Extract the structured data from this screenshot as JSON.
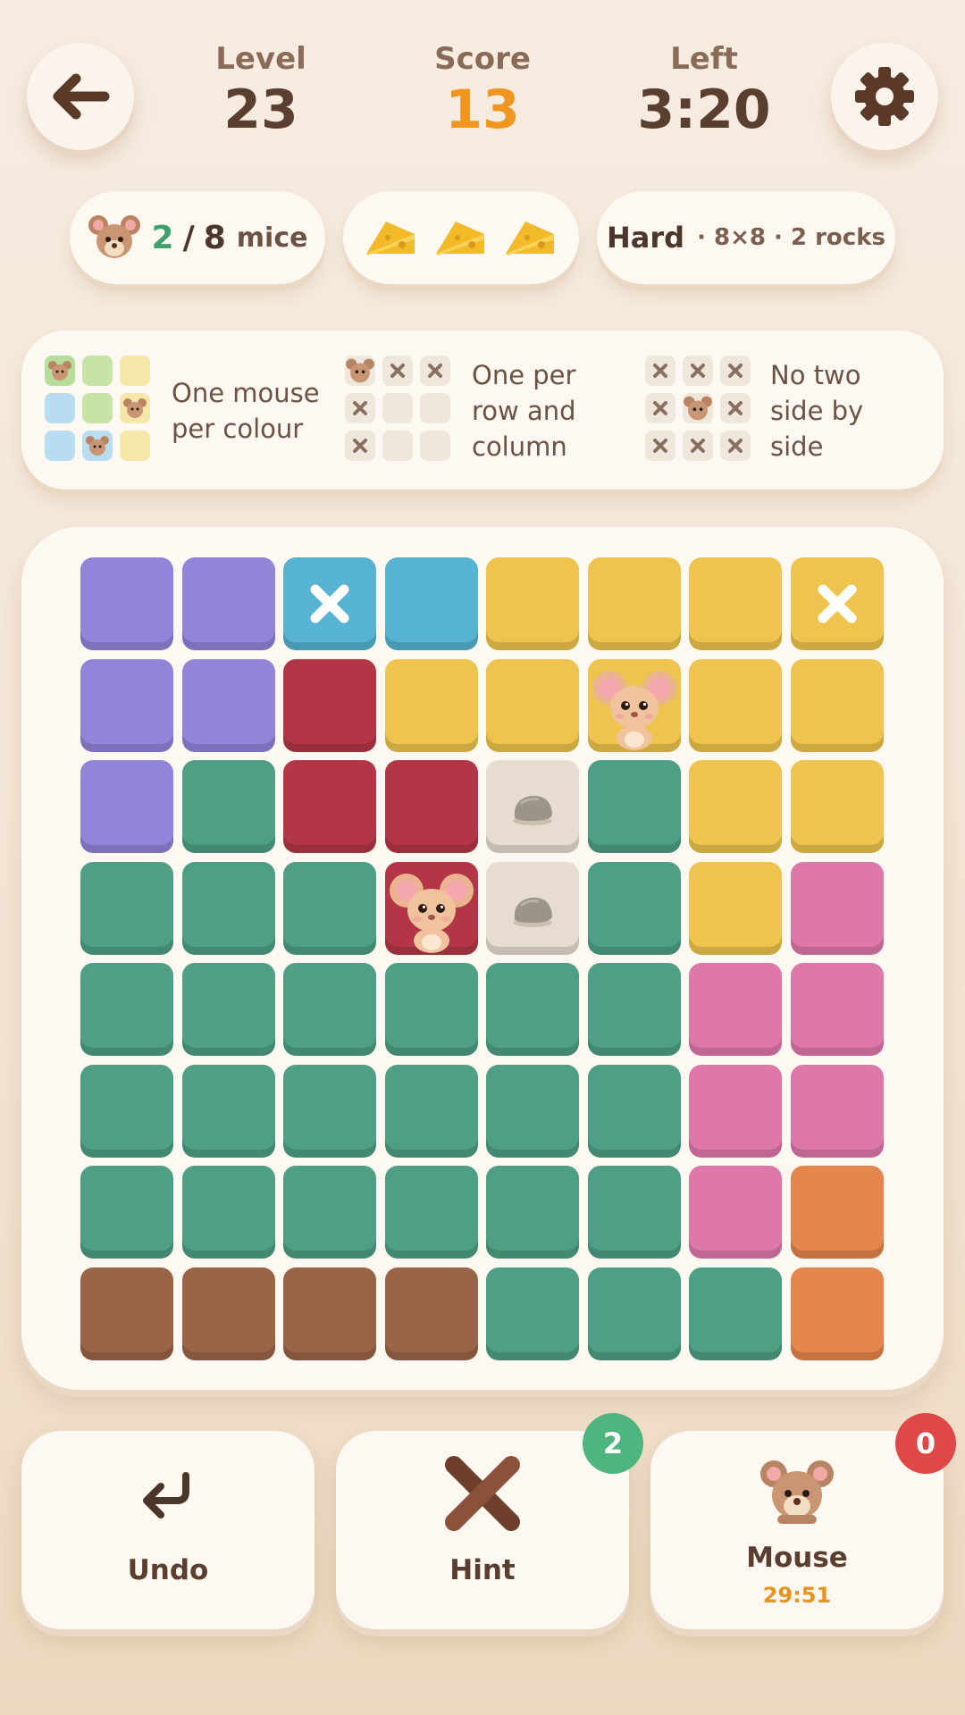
{
  "header": {
    "level_label": "Level",
    "level_value": "23",
    "score_label": "Score",
    "score_value": "13",
    "left_label": "Left",
    "left_value": "3:20"
  },
  "status": {
    "mice_found": "2",
    "mice_sep": "/",
    "mice_total": "8",
    "mice_label": "mice",
    "difficulty": "Hard",
    "board_info": "· 8×8 · 2 rocks",
    "cheese_count": 3
  },
  "rules": [
    {
      "text_line1": "One mouse",
      "text_line2": "per colour"
    },
    {
      "text_line1": "One per",
      "text_line2": "row and",
      "text_line3": "column"
    },
    {
      "text_line1": "No two",
      "text_line2": "side by",
      "text_line3": "side"
    }
  ],
  "colors": {
    "purple": "#9284d8",
    "blue": "#56b3d1",
    "yellow": "#eec44e",
    "red": "#b33647",
    "rock": "#e6dcd0",
    "green": "#4f9f86",
    "pink": "#df78aa",
    "orange": "#e6854c",
    "brown": "#9a6547"
  },
  "board": {
    "rows": [
      [
        "purple",
        "purple",
        "blue",
        "blue",
        "yellow",
        "yellow",
        "yellow",
        "yellow"
      ],
      [
        "purple",
        "purple",
        "red",
        "yellow",
        "yellow",
        "yellow",
        "yellow",
        "yellow"
      ],
      [
        "purple",
        "green",
        "red",
        "red",
        "rock",
        "green",
        "yellow",
        "yellow"
      ],
      [
        "green",
        "green",
        "green",
        "red",
        "rock",
        "green",
        "yellow",
        "pink"
      ],
      [
        "green",
        "green",
        "green",
        "green",
        "green",
        "green",
        "pink",
        "pink"
      ],
      [
        "green",
        "green",
        "green",
        "green",
        "green",
        "green",
        "pink",
        "pink"
      ],
      [
        "green",
        "green",
        "green",
        "green",
        "green",
        "green",
        "pink",
        "orange"
      ],
      [
        "brown",
        "brown",
        "brown",
        "brown",
        "green",
        "green",
        "green",
        "orange"
      ]
    ],
    "marks": [
      {
        "row": 0,
        "col": 2,
        "type": "x"
      },
      {
        "row": 0,
        "col": 7,
        "type": "x"
      },
      {
        "row": 1,
        "col": 5,
        "type": "mouse"
      },
      {
        "row": 3,
        "col": 3,
        "type": "mouse"
      }
    ]
  },
  "actions": {
    "undo_label": "Undo",
    "hint_label": "Hint",
    "hint_badge": "2",
    "mouse_label": "Mouse",
    "mouse_timer": "29:51",
    "mouse_badge": "0"
  }
}
